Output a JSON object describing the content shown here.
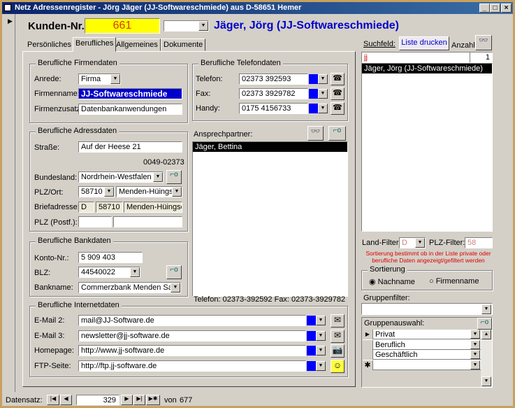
{
  "window": {
    "title": "Netz Adressenregister - Jörg Jäger (JJ-Softwareschmiede) aus D-58651 Hemer",
    "min": "_",
    "max": "□",
    "close": "×"
  },
  "header": {
    "kunden_label": "Kunden-Nr.:",
    "kunden_nr": "661",
    "contact_name": "Jäger, Jörg (JJ-Softwareschmiede)"
  },
  "tabs": [
    {
      "label": "Persönliches"
    },
    {
      "label": "Berufliches",
      "active": true
    },
    {
      "label": "Allgemeines"
    },
    {
      "label": "Dokumente"
    }
  ],
  "firmendaten": {
    "legend": "Berufliche Firmendaten",
    "anrede_label": "Anrede:",
    "anrede": "Firma",
    "firmenname_label": "Firmenname:",
    "firmenname": "JJ-Softwareschmiede",
    "firmenzusatz_label": "Firmenzusatz",
    "firmenzusatz": "Datenbankanwendungen"
  },
  "adressdaten": {
    "legend": "Berufliche Adressdaten",
    "strasse_label": "Straße:",
    "strasse": "Auf der Heese 21",
    "vorwahl": "0049-02373",
    "bundesland_label": "Bundesland:",
    "bundesland": "Nordrhein-Westfalen",
    "plzort_label": "PLZ/Ort:",
    "plz": "58710",
    "ort": "Menden-Hüingsen",
    "brief_label": "Briefadresse:",
    "brief_land": "D",
    "brief_plz": "58710",
    "brief_ort": "Menden-Hüingsen",
    "postf_label": "PLZ (Postf.):",
    "postf_plz": "",
    "postf": ""
  },
  "bankdaten": {
    "legend": "Berufliche Bankdaten",
    "konto_label": "Konto-Nr.:",
    "konto": "5 909 403",
    "blz_label": "BLZ:",
    "blz": "44540022",
    "bank_label": "Bankname:",
    "bank": "Commerzbank Menden Sauerland"
  },
  "telefon": {
    "legend": "Berufliche Telefondaten",
    "rows": [
      {
        "label": "Telefon:",
        "value": "02373 392593"
      },
      {
        "label": "Fax:",
        "value": "02373 3929782"
      },
      {
        "label": "Handy:",
        "value": "0175 4156733"
      }
    ]
  },
  "ansprechpartner": {
    "label": "Ansprechpartner:",
    "items": [
      "Jäger, Bettina"
    ],
    "info": "Telefon: 02373-392592 Fax: 02373-3929782"
  },
  "internet": {
    "legend": "Berufliche Internetdaten",
    "rows": [
      {
        "label": "E-Mail 2:",
        "value": "mail@JJ-Software.de",
        "icon": "email-icon"
      },
      {
        "label": "E-Mail 3:",
        "value": "newsletter@jj-software.de",
        "icon": "email-icon"
      },
      {
        "label": "Homepage:",
        "value": "http://www.jj-software.de",
        "icon": "camera-icon"
      },
      {
        "label": "FTP-Seite:",
        "value": "http://ftp.jj-software.de",
        "icon": "smiley-icon"
      }
    ]
  },
  "search": {
    "label": "Suchfeld:",
    "print_button": "Liste drucken",
    "count_label": "Anzahl:",
    "query": "jj",
    "count": "1",
    "results": [
      "Jäger, Jörg (JJ-Softwareschmiede)"
    ]
  },
  "filters": {
    "land_label": "Land-Filter:",
    "land": "D",
    "plz_label": "PLZ-Filter:",
    "plz": "58",
    "note": "Sortierung bestimmt ob in der Liste private oder berufliche Daten angezeigt/gefiltert werden",
    "sort_legend": "Sortierung",
    "sort_options": [
      "Nachname",
      "Firmenname"
    ],
    "sort_selected": "Nachname",
    "gruppenfilter_label": "Gruppenfilter:",
    "gruppenfilter": "",
    "gruppenauswahl_label": "Gruppenauswahl:",
    "groups": [
      "Privat",
      "Beruflich",
      "Geschäftlich"
    ],
    "new_row_marker": "✱"
  },
  "nav": {
    "label": "Datensatz:",
    "current": "329",
    "of_label": "von",
    "total": "677"
  },
  "colors": {
    "title_bar": "#0a246a",
    "kunden_bg": "#ffff00",
    "kunden_fg": "#d04000",
    "name_fg": "#0000cc",
    "selection": "#0000cc",
    "note_fg": "#e00000"
  }
}
